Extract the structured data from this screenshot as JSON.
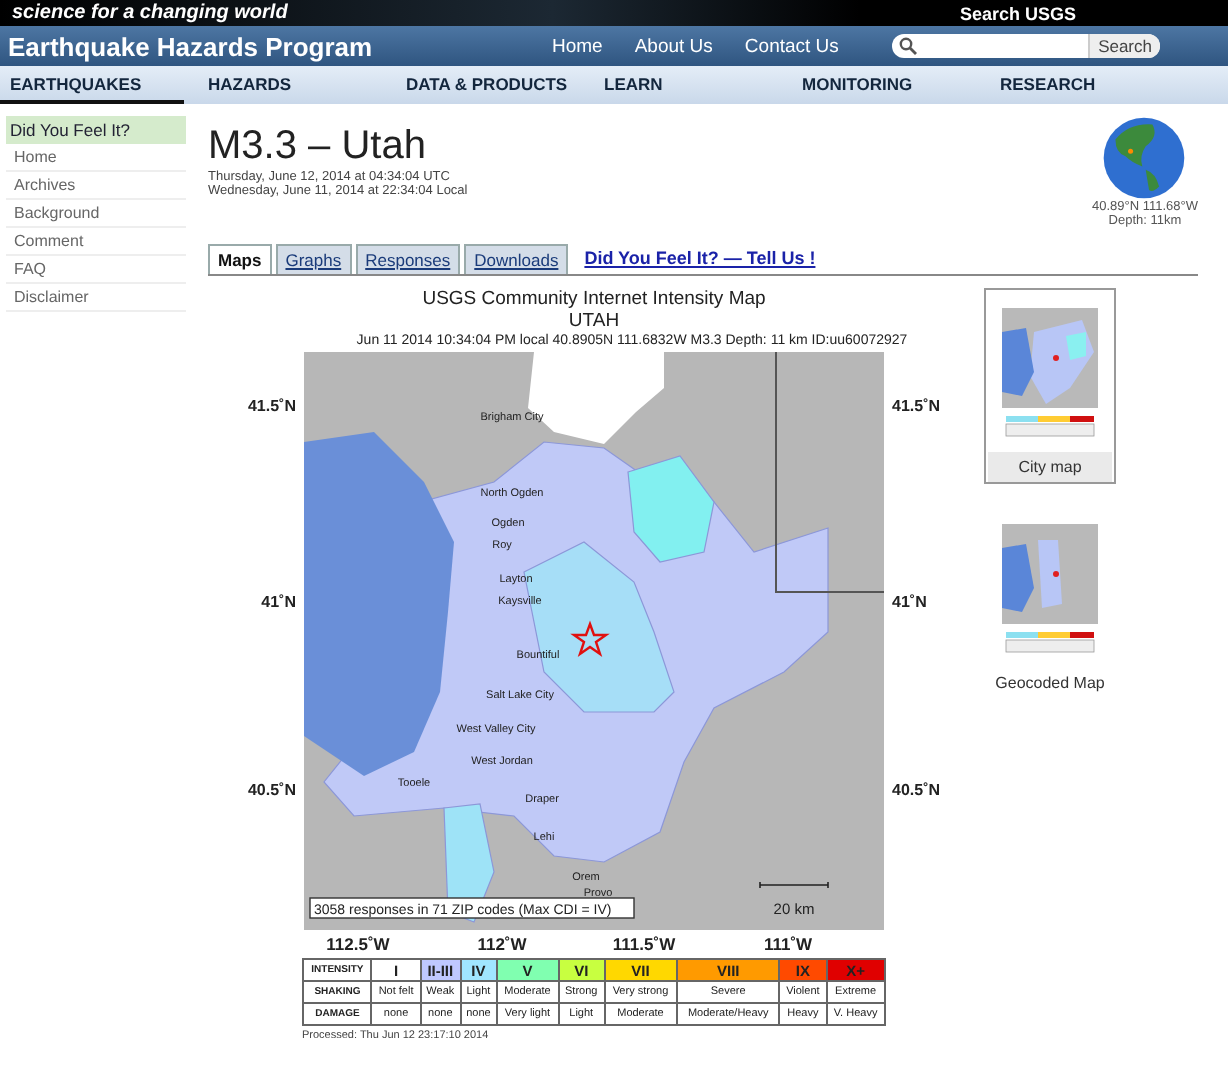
{
  "banner": {
    "tagline": "science for a changing world",
    "search_label": "Search USGS"
  },
  "header": {
    "title": "Earthquake Hazards Program",
    "links": [
      "Home",
      "About Us",
      "Contact Us"
    ],
    "search": {
      "button": "Search"
    }
  },
  "nav": [
    {
      "label": "EARTHQUAKES",
      "selected": true
    },
    {
      "label": "HAZARDS",
      "selected": false
    },
    {
      "label": "DATA & PRODUCTS",
      "selected": false
    },
    {
      "label": "LEARN",
      "selected": false
    },
    {
      "label": "MONITORING",
      "selected": false
    },
    {
      "label": "RESEARCH",
      "selected": false
    }
  ],
  "sidebar": {
    "title": "Did You Feel It?",
    "items": [
      "Home",
      "Archives",
      "Background",
      "Comment",
      "FAQ",
      "Disclaimer"
    ]
  },
  "event": {
    "title": "M3.3 – Utah",
    "utc": "Thursday, June 12, 2014 at 04:34:04 UTC",
    "local": "Wednesday, June 11, 2014 at 22:34:04 Local",
    "coords": "40.89°N 111.68°W",
    "depth": "Depth: 11km"
  },
  "tabs": [
    {
      "label": "Maps",
      "selected": true
    },
    {
      "label": "Graphs",
      "selected": false
    },
    {
      "label": "Responses",
      "selected": false
    },
    {
      "label": "Downloads",
      "selected": false
    }
  ],
  "tell_us_link": "Did You Feel It? — Tell Us !",
  "map": {
    "title": "USGS Community Internet Intensity Map",
    "region": "UTAH",
    "subtitle": "Jun 11 2014 10:34:04 PM local 40.8905N 111.6832W M3.3 Depth: 11 km ID:uu60072927",
    "lat_labels_left": [
      "41.5˚N",
      "41˚N",
      "40.5˚N"
    ],
    "lat_labels_right": [
      "41.5˚N",
      "41˚N",
      "40.5˚N"
    ],
    "lon_labels": [
      "112.5˚W",
      "112˚W",
      "111.5˚W",
      "111˚W"
    ],
    "cities": [
      "Brigham City",
      "North Ogden",
      "Ogden",
      "Roy",
      "Layton",
      "Kaysville",
      "Bountiful",
      "Salt Lake City",
      "West Valley City",
      "West Jordan",
      "Tooele",
      "Draper",
      "Lehi",
      "Orem",
      "Provo"
    ],
    "caption": "3058 responses in 71 ZIP codes (Max CDI = IV)",
    "scale": "20 km"
  },
  "legend": {
    "row_labels": [
      "INTENSITY",
      "SHAKING",
      "DAMAGE"
    ],
    "columns": [
      {
        "intensity": "I",
        "shaking": "Not felt",
        "damage": "none",
        "color": "#ffffff"
      },
      {
        "intensity": "II-III",
        "shaking": "Weak",
        "damage": "none",
        "color": "#bfc8ff"
      },
      {
        "intensity": "IV",
        "shaking": "Light",
        "damage": "none",
        "color": "#a0e6ff"
      },
      {
        "intensity": "V",
        "shaking": "Moderate",
        "damage": "Very light",
        "color": "#80ffb0"
      },
      {
        "intensity": "VI",
        "shaking": "Strong",
        "damage": "Light",
        "color": "#c8ff40"
      },
      {
        "intensity": "VII",
        "shaking": "Very strong",
        "damage": "Moderate",
        "color": "#ffd800"
      },
      {
        "intensity": "VIII",
        "shaking": "Severe",
        "damage": "Moderate/Heavy",
        "color": "#ff9a00"
      },
      {
        "intensity": "IX",
        "shaking": "Violent",
        "damage": "Heavy",
        "color": "#ff4a00"
      },
      {
        "intensity": "X+",
        "shaking": "Extreme",
        "damage": "V. Heavy",
        "color": "#e00000"
      }
    ]
  },
  "processed": "Processed: Thu Jun 12 23:17:10 2014",
  "thumbnails": [
    {
      "label": "City map",
      "selected": true
    },
    {
      "label": "Geocoded Map",
      "selected": false
    }
  ]
}
